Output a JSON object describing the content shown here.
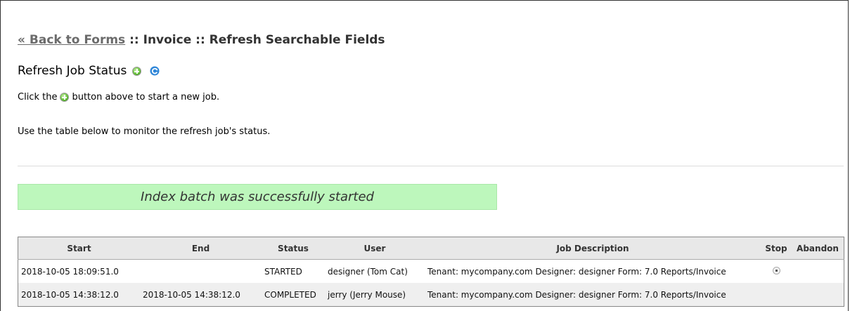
{
  "header": {
    "back_link": "« Back to Forms",
    "title_suffix": " :: Invoice :: Refresh Searchable Fields"
  },
  "subtitle": "Refresh Job Status",
  "instructions": {
    "line1_before": "Click the",
    "line1_after": "button above to start a new job.",
    "line2": "Use the table below to monitor the refresh job's status."
  },
  "banner": "Index batch was successfully started",
  "table": {
    "headers": {
      "start": "Start",
      "end": "End",
      "status": "Status",
      "user": "User",
      "description": "Job Description",
      "stop": "Stop",
      "abandon": "Abandon"
    },
    "rows": [
      {
        "start": "2018-10-05 18:09:51.0",
        "end": "",
        "status": "STARTED",
        "user": "designer (Tom Cat)",
        "description": "Tenant: mycompany.com Designer: designer Form: 7.0 Reports/Invoice"
      },
      {
        "start": "2018-10-05 14:38:12.0",
        "end": "2018-10-05 14:38:12.0",
        "status": "COMPLETED",
        "user": "jerry (Jerry Mouse)",
        "description": "Tenant: mycompany.com Designer: designer Form: 7.0 Reports/Invoice"
      }
    ]
  },
  "icons": {
    "add": "add-circle-icon",
    "refresh": "refresh-icon",
    "stop": "stop-icon"
  },
  "colors": {
    "banner_bg": "#bdf7bc",
    "link": "#6b6b6b"
  }
}
